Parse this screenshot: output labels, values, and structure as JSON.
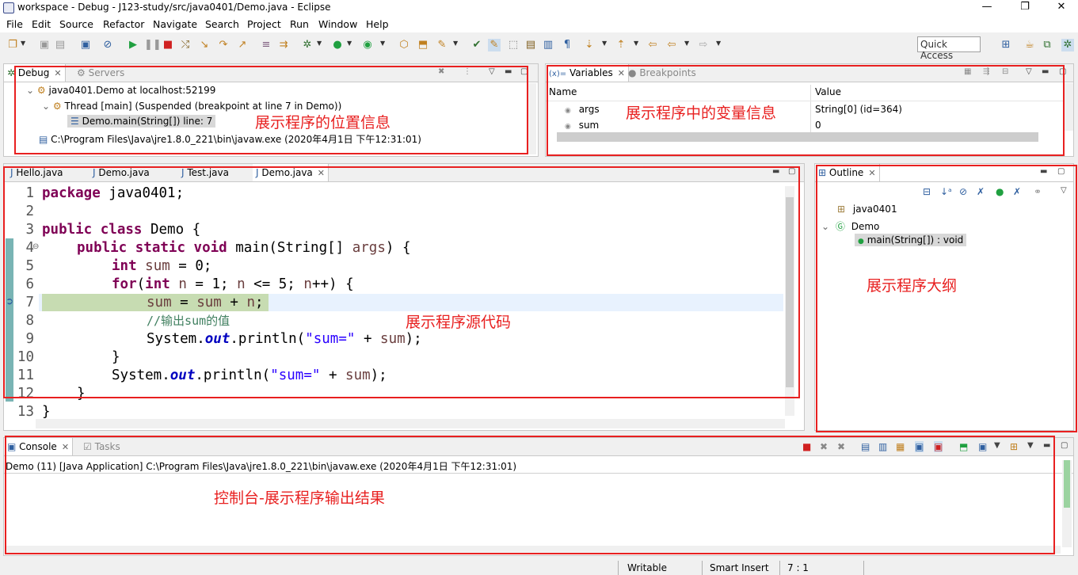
{
  "window": {
    "title": "workspace - Debug - J123-study/src/java0401/Demo.java - Eclipse",
    "minimize": "—",
    "restore": "❐",
    "close": "✕"
  },
  "menu": [
    "File",
    "Edit",
    "Source",
    "Refactor",
    "Navigate",
    "Search",
    "Project",
    "Run",
    "Window",
    "Help"
  ],
  "toolbar": {
    "quick_access": "Quick Access"
  },
  "debug_view": {
    "tabs": [
      "Debug",
      "Servers"
    ],
    "tree": [
      "java0401.Demo at localhost:52199",
      "Thread [main] (Suspended (breakpoint at line 7 in Demo))",
      "Demo.main(String[]) line: 7",
      "C:\\Program Files\\Java\\jre1.8.0_221\\bin\\javaw.exe (2020年4月1日 下午12:31:01)"
    ],
    "annotation": "展示程序的位置信息"
  },
  "variables_view": {
    "tabs": [
      "Variables",
      "Breakpoints"
    ],
    "columns": [
      "Name",
      "Value"
    ],
    "rows": [
      {
        "name": "args",
        "value": "String[0]  (id=364)"
      },
      {
        "name": "sum",
        "value": "0"
      }
    ],
    "annotation": "展示程序中的变量信息"
  },
  "editor": {
    "tabs": [
      "Hello.java",
      "Demo.java",
      "Test.java",
      "Demo.java"
    ],
    "active_tab": 3,
    "line_numbers": [
      "1",
      "2",
      "3",
      "4",
      "5",
      "6",
      "7",
      "8",
      "9",
      "10",
      "11",
      "12",
      "13"
    ],
    "current_line": 7,
    "annotation": "展示程序源代码",
    "code": {
      "l1_kw": "package",
      "l1_rest": " java0401;",
      "l3_kw1": "public",
      "l3_kw2": "class",
      "l3_rest": " Demo {",
      "l4_kw1": "public",
      "l4_kw2": "static",
      "l4_kw3": "void",
      "l4_a": " main(String[] ",
      "l4_var": "args",
      "l4_b": ") {",
      "l5_kw": "int",
      "l5_var": "sum",
      "l5_rest": " = 0;",
      "l6_kw1": "for",
      "l6_a": "(",
      "l6_kw2": "int",
      "l6_var1": "n",
      "l6_b": " = 1; ",
      "l6_var2": "n",
      "l6_c": " <= 5; ",
      "l6_var3": "n",
      "l6_d": "++) {",
      "l7_var1": "sum",
      "l7_a": " = ",
      "l7_var2": "sum",
      "l7_b": " + ",
      "l7_var3": "n",
      "l7_c": ";",
      "l8_comment": "//输出sum的值",
      "l9_a": "System.",
      "l9_fld": "out",
      "l9_b": ".println(",
      "l9_str": "\"sum=\"",
      "l9_c": " + ",
      "l9_var": "sum",
      "l9_d": ");",
      "l10": "}",
      "l11_a": "System.",
      "l11_fld": "out",
      "l11_b": ".println(",
      "l11_str": "\"sum=\"",
      "l11_c": " + ",
      "l11_var": "sum",
      "l11_d": ");",
      "l12": "}",
      "l13": "}"
    }
  },
  "outline_view": {
    "tab": "Outline",
    "items": [
      "java0401",
      "Demo",
      "main(String[]) : void"
    ],
    "annotation": "展示程序大纲"
  },
  "console_view": {
    "tabs": [
      "Console",
      "Tasks"
    ],
    "header": "Demo (11) [Java Application] C:\\Program Files\\Java\\jre1.8.0_221\\bin\\javaw.exe (2020年4月1日 下午12:31:01)",
    "annotation": "控制台-展示程序输出结果"
  },
  "statusbar": {
    "writable": "Writable",
    "insert_mode": "Smart Insert",
    "position": "7 : 1"
  },
  "colors": {
    "annotation_red": "#e82020",
    "current_line_bg": "#c7dcb2",
    "keyword": "#7f0055",
    "string": "#2a00ff"
  }
}
